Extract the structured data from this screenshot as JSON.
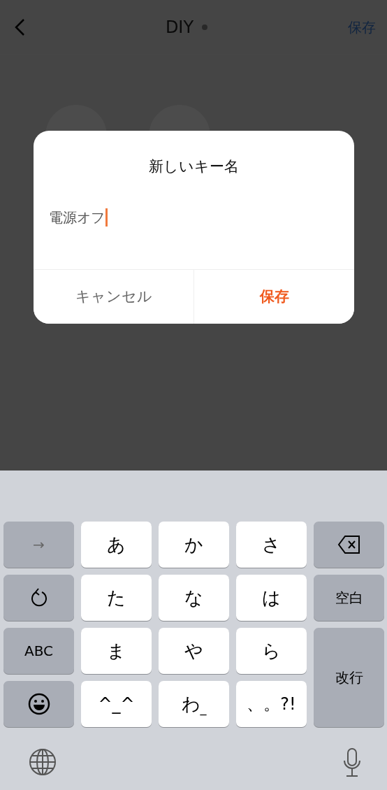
{
  "header": {
    "title": "DIY",
    "save": "保存"
  },
  "dialog": {
    "title": "新しいキー名",
    "input_value": "電源オフ",
    "buttons": [
      {
        "label": "キャンセル",
        "kind": "cancel"
      },
      {
        "label": "保存",
        "kind": "confirm"
      }
    ]
  },
  "keyboard": {
    "keys": [
      {
        "kind": "next",
        "label": "→"
      },
      {
        "kind": "char",
        "label": "あ"
      },
      {
        "kind": "char",
        "label": "か"
      },
      {
        "kind": "char",
        "label": "さ"
      },
      {
        "kind": "delete"
      },
      {
        "kind": "undo"
      },
      {
        "kind": "char",
        "label": "た"
      },
      {
        "kind": "char",
        "label": "な"
      },
      {
        "kind": "char",
        "label": "は"
      },
      {
        "kind": "function",
        "label": "空白"
      },
      {
        "kind": "function",
        "label": "ABC"
      },
      {
        "kind": "char",
        "label": "ま"
      },
      {
        "kind": "char",
        "label": "や"
      },
      {
        "kind": "char",
        "label": "ら"
      },
      {
        "kind": "return",
        "label": "改行"
      },
      {
        "kind": "emoji"
      },
      {
        "kind": "char",
        "label": "^_^"
      },
      {
        "kind": "char",
        "label": "わ",
        "hint": "_"
      },
      {
        "kind": "char",
        "label": "、。?!"
      }
    ]
  }
}
